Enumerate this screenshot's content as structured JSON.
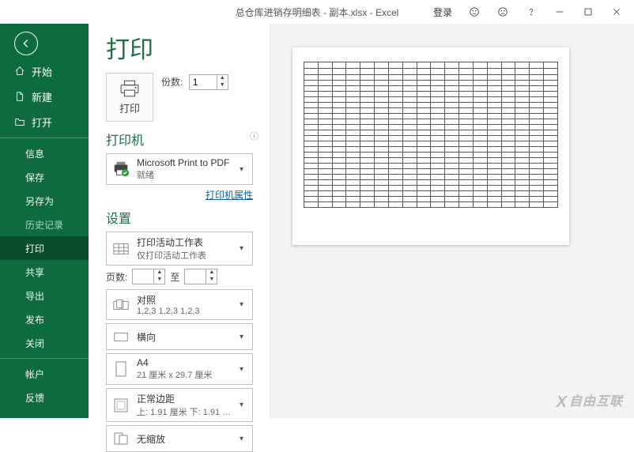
{
  "titlebar": {
    "filename": "总仓库进销存明细表 - 副本.xlsx  -  Excel",
    "login": "登录"
  },
  "sidebar": {
    "home": "开始",
    "new": "新建",
    "open": "打开",
    "info": "信息",
    "save": "保存",
    "saveas": "另存为",
    "history": "历史记录",
    "print": "打印",
    "share": "共享",
    "export": "导出",
    "publish": "发布",
    "close": "关闭",
    "account": "帐户",
    "feedback": "反馈"
  },
  "page": {
    "title": "打印",
    "copies_label": "份数:",
    "copies_value": "1",
    "print_button": "打印",
    "printer_heading": "打印机",
    "printer_name": "Microsoft Print to PDF",
    "printer_status": "就绪",
    "printer_props": "打印机属性",
    "settings_heading": "设置",
    "setting_sheets_title": "打印活动工作表",
    "setting_sheets_sub": "仅打印活动工作表",
    "pages_label": "页数:",
    "pages_to": "至",
    "collate_title": "对照",
    "collate_sub": "1,2,3    1,2,3    1,2,3",
    "orientation_title": "横向",
    "paper_title": "A4",
    "paper_sub": "21 厘米 x 29.7 厘米",
    "margins_title": "正常边距",
    "margins_sub": "上: 1.91 厘米 下: 1.91 厘…",
    "scaling_title": "无缩放"
  },
  "watermark": "自由互联"
}
